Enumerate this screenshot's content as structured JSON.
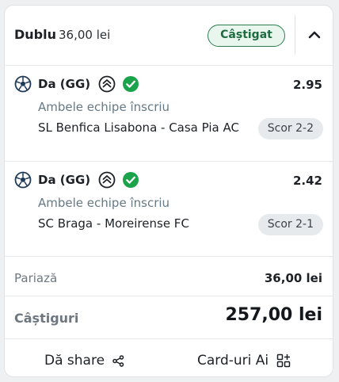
{
  "header": {
    "bet_type": "Dublu",
    "stake": "36,00 lei",
    "status": "Câștigat",
    "collapse_icon": "chevron-up-icon"
  },
  "selections": [
    {
      "pick": "Da (GG)",
      "odds": "2.95",
      "market": "Ambele echipe înscriu",
      "event": "SL Benfica Lisabona - Casa Pia AC",
      "score": "Scor 2-2"
    },
    {
      "pick": "Da (GG)",
      "odds": "2.42",
      "market": "Ambele echipe înscriu",
      "event": "SC Braga - Moreirense FC",
      "score": "Scor 2-1"
    }
  ],
  "summary": {
    "stake_label": "Pariază",
    "stake_value": "36,00 lei",
    "winnings_label": "Câștiguri",
    "winnings_value": "257,00 lei"
  },
  "footer": {
    "share_label": "Dă share",
    "cards_label": "Card-uri Ai"
  },
  "colors": {
    "won_green": "#2e7d4f",
    "check_green": "#1aa34a",
    "muted_text": "#667985"
  }
}
